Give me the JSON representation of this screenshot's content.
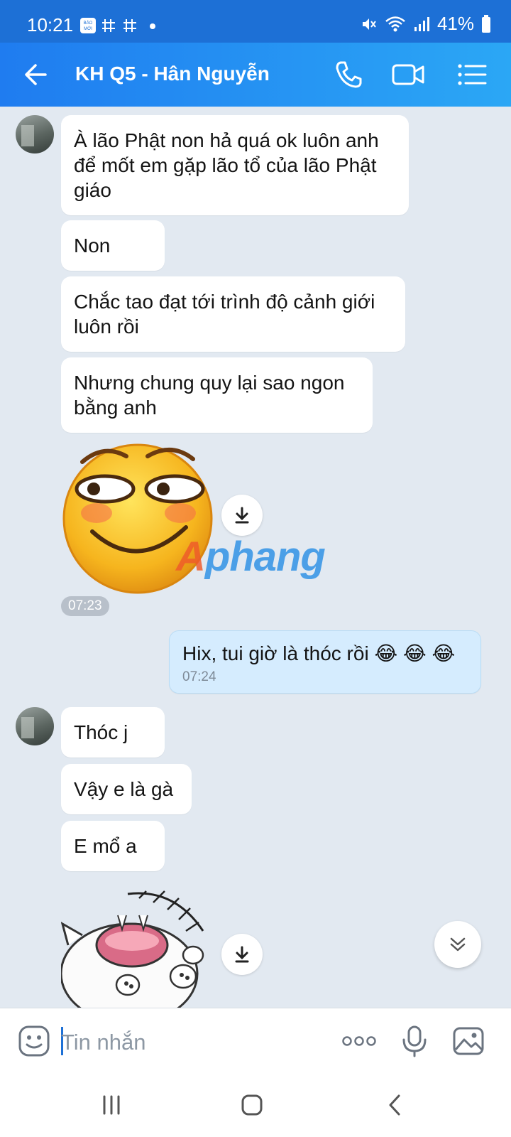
{
  "status_bar": {
    "time": "10:21",
    "notif_label": "BÁO MỚI",
    "battery": "41%"
  },
  "header": {
    "title": "KH Q5 - Hân Nguyễn"
  },
  "messages": {
    "m1": "À lão Phật non hả quá ok luôn anh để mốt em gặp lão tổ của lão Phật giáo",
    "m2": "Non",
    "m3": "Chắc tao đạt tới trình độ cảnh giới luôn rồi",
    "m4": "Nhưng chung quy lại sao ngon bằng anh",
    "sticker_time": "07:23",
    "m5": "Hix, tui giờ là thóc rồi 😂 😂 😂",
    "m5_time": "07:24",
    "m6": "Thóc j",
    "m7": "Vậy e là gà",
    "m8": "E mổ a"
  },
  "watermark": {
    "prefix": "A",
    "rest": "phang"
  },
  "input": {
    "placeholder": "Tin nhắn"
  },
  "colors": {
    "header_start": "#1f7cf0",
    "header_end": "#2ba7f5",
    "chat_bg": "#e2e9f1",
    "mine_bubble": "#d5ecfe"
  },
  "icons": {
    "header": [
      "back-arrow-icon",
      "phone-icon",
      "video-call-icon",
      "menu-list-icon"
    ],
    "input": [
      "emoji-icon",
      "more-dots-icon",
      "microphone-icon",
      "image-icon"
    ],
    "nav": [
      "recents-icon",
      "home-icon",
      "back-icon"
    ]
  }
}
